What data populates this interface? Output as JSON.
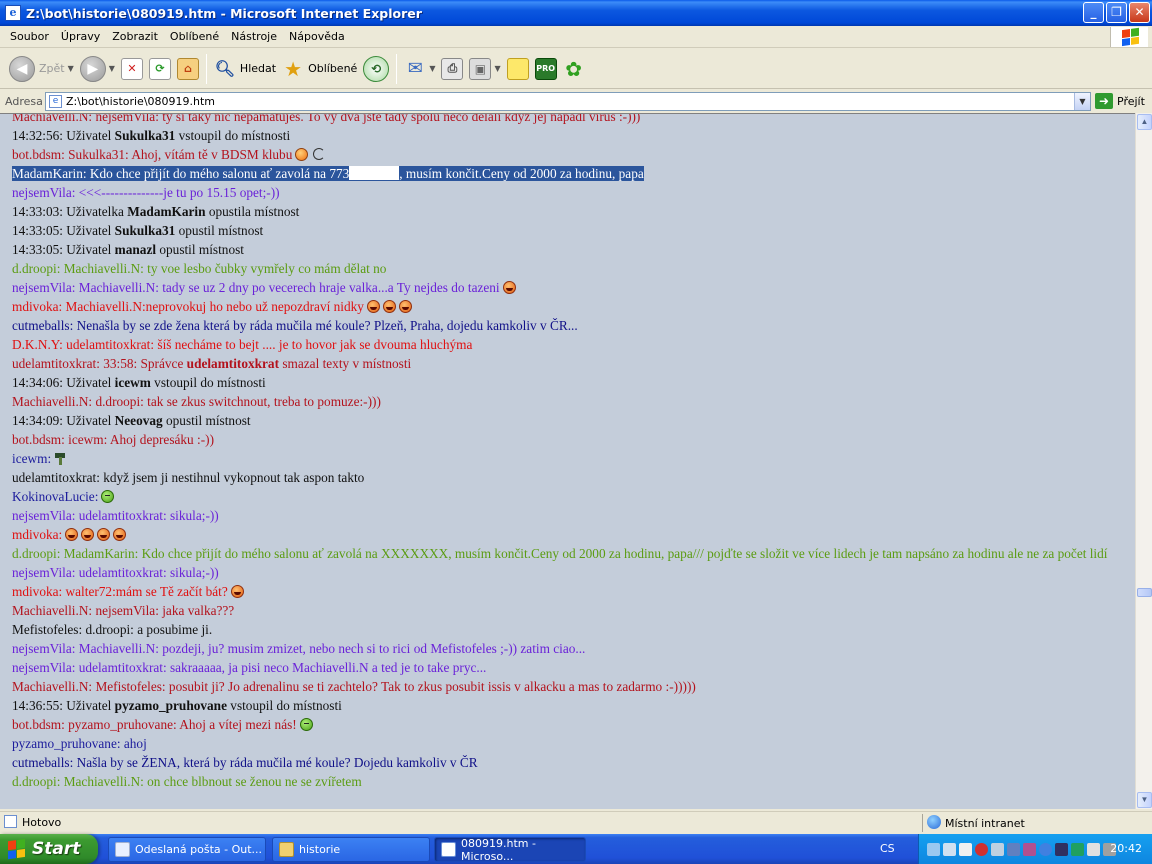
{
  "window": {
    "title": "Z:\\bot\\historie\\080919.htm - Microsoft Internet Explorer"
  },
  "menu": [
    "Soubor",
    "Úpravy",
    "Zobrazit",
    "Oblíbené",
    "Nástroje",
    "Nápověda"
  ],
  "toolbar": {
    "back_label": "Zpět",
    "search_label": "Hledat",
    "favorites_label": "Oblíbené"
  },
  "address": {
    "label": "Adresa",
    "value": "Z:\\bot\\historie\\080919.htm",
    "go_label": "Přejít"
  },
  "chat": [
    {
      "color": "c-darkred",
      "text": "Machiavelli.N: nejsemVila: ty si taky nic nepamatujes. To vy dva jste tady spolu neco delali kdyz jej napadl virus :-)))"
    },
    {
      "color": "c-black",
      "parts": [
        {
          "t": "14:32:56: Uživatel "
        },
        {
          "t": "Sukulka31",
          "b": true
        },
        {
          "t": " vstoupil do místnosti"
        }
      ]
    },
    {
      "color": "c-darkred",
      "text": "bot.bdsm: Sukulka31: Ahoj, vítám tě v BDSM klubu",
      "emo": [
        "blink",
        "whip"
      ]
    },
    {
      "color": "sel",
      "parts": [
        {
          "t": "MadamKarin: Kdo chce přijít do mého salonu ať zavolá na 773"
        },
        {
          "redact": true
        },
        {
          "t": ", musím končit.Ceny od 2000 za hodinu, papa"
        }
      ]
    },
    {
      "color": "c-purple",
      "text": "nejsemVila: <<<--------------je tu po 15.15 opet;-))"
    },
    {
      "color": "c-black",
      "parts": [
        {
          "t": "14:33:03: Uživatelka "
        },
        {
          "t": "MadamKarin",
          "b": true
        },
        {
          "t": " opustila místnost"
        }
      ]
    },
    {
      "color": "c-black",
      "parts": [
        {
          "t": "14:33:05: Uživatel "
        },
        {
          "t": "Sukulka31",
          "b": true
        },
        {
          "t": " opustil místnost"
        }
      ]
    },
    {
      "color": "c-black",
      "parts": [
        {
          "t": "14:33:05: Uživatel "
        },
        {
          "t": "manazl",
          "b": true
        },
        {
          "t": " opustil místnost"
        }
      ]
    },
    {
      "color": "c-green",
      "text": "d.droopi: Machiavelli.N: ty voe lesbo čubky vymřely co mám dělat no"
    },
    {
      "color": "c-purple",
      "text": "nejsemVila: Machiavelli.N: tady se uz 2 dny po vecerech hraje valka...a Ty nejdes do tazeni",
      "emo": [
        "laugh"
      ]
    },
    {
      "color": "c-bright",
      "text": "mdivoka: Machiavelli.N:neprovokuj ho nebo už nepozdraví nidky",
      "emo": [
        "laugh",
        "laugh",
        "laugh"
      ]
    },
    {
      "color": "c-navy",
      "text": "cutmeballs: Nenašla by se zde žena která by ráda mučila mé koule? Plzeň, Praha, dojedu kamkoliv v ČR..."
    },
    {
      "color": "c-bright",
      "text": "D.K.N.Y: udelamtitoxkrat: šíš necháme to bejt .... je to hovor jak se dvouma hluchýma"
    },
    {
      "color": "c-darkred",
      "parts": [
        {
          "t": "udelamtitoxkrat: 33:58: Správce "
        },
        {
          "t": "udelamtitoxkrat",
          "b": true
        },
        {
          "t": " smazal texty v místnosti"
        }
      ]
    },
    {
      "color": "c-black",
      "parts": [
        {
          "t": "14:34:06: Uživatel "
        },
        {
          "t": "icewm",
          "b": true
        },
        {
          "t": " vstoupil do místnosti"
        }
      ]
    },
    {
      "color": "c-darkred",
      "text": "Machiavelli.N: d.droopi: tak se zkus switchnout, treba to pomuze:-)))"
    },
    {
      "color": "c-black",
      "parts": [
        {
          "t": "14:34:09: Uživatel "
        },
        {
          "t": "Neeovag",
          "b": true
        },
        {
          "t": " opustil místnost"
        }
      ]
    },
    {
      "color": "c-darkred",
      "text": "bot.bdsm: icewm: Ahoj depresáku :-))"
    },
    {
      "color": "c-blue",
      "text": "icewm:",
      "emo": [
        "hammer"
      ]
    },
    {
      "color": "c-black",
      "text": "udelamtitoxkrat: když jsem ji nestihnul vykopnout tak aspon takto"
    },
    {
      "color": "c-blue",
      "text": "KokinovaLucie:",
      "emo": [
        "smile"
      ]
    },
    {
      "color": "c-purple",
      "text": "nejsemVila: udelamtitoxkrat: sikula;-))"
    },
    {
      "color": "c-bright",
      "text": "mdivoka:",
      "emo": [
        "laugh",
        "laugh",
        "laugh",
        "laugh"
      ]
    },
    {
      "color": "c-green",
      "wrap": true,
      "text": "d.droopi: MadamKarin: Kdo chce přijít do mého salonu ať zavolá na XXXXXXX, musím končit.Ceny od 2000 za hodinu, papa/// pojďte se složit ve více lidech je tam napsáno za hodinu ale ne za počet lidí"
    },
    {
      "color": "c-purple",
      "text": "nejsemVila: udelamtitoxkrat: sikula;-))"
    },
    {
      "color": "c-bright",
      "text": "mdivoka: walter72:mám se Tě začít bát?",
      "emo": [
        "laugh"
      ]
    },
    {
      "color": "c-darkred",
      "text": "Machiavelli.N: nejsemVila: jaka valka???"
    },
    {
      "color": "c-black",
      "text": "Mefistofeles: d.droopi: a posubime ji."
    },
    {
      "color": "c-purple",
      "text": "nejsemVila: Machiavelli.N: pozdeji, ju? musim zmizet, nebo nech si to rici od Mefistofeles ;-)) zatim ciao..."
    },
    {
      "color": "c-purple",
      "text": "nejsemVila: udelamtitoxkrat: sakraaaaa, ja pisi neco Machiavelli.N a ted je to take pryc..."
    },
    {
      "color": "c-darkred",
      "text": "Machiavelli.N: Mefistofeles: posubit ji? Jo adrenalinu se ti zachtelo? Tak to zkus posubit issis v alkacku a mas to zadarmo :-)))))"
    },
    {
      "color": "c-black",
      "parts": [
        {
          "t": "14:36:55: Uživatel "
        },
        {
          "t": "pyzamo_pruhovane",
          "b": true
        },
        {
          "t": " vstoupil do místnosti"
        }
      ]
    },
    {
      "color": "c-darkred",
      "text": "bot.bdsm: pyzamo_pruhovane: Ahoj a vítej mezi nás!",
      "emo": [
        "smile"
      ]
    },
    {
      "color": "c-blue",
      "text": "pyzamo_pruhovane: ahoj"
    },
    {
      "color": "c-navy",
      "text": "cutmeballs: Našla by se ŽENA, která by ráda mučila mé koule? Dojedu kamkoliv v ČR"
    },
    {
      "color": "c-green",
      "text": "d.droopi: Machiavelli.N: on chce blbnout se ženou ne se zvířetem"
    }
  ],
  "status": {
    "text": "Hotovo",
    "zone": "Místní intranet"
  },
  "taskbar": {
    "start_label": "Start",
    "tasks": [
      {
        "label": "Odeslaná pošta - Out..."
      },
      {
        "label": "historie"
      },
      {
        "label": "080919.htm - Microso..."
      }
    ],
    "lang": "CS",
    "clock": "20:42"
  },
  "colors": {
    "content_bg": "#C4CDDA",
    "selection": "#2B559C",
    "titlebar": "#0054E3",
    "taskbar": "#245EDC",
    "start": "#3C9A30"
  },
  "icons": [
    "ie-icon",
    "back-icon",
    "forward-icon",
    "stop-icon",
    "refresh-icon",
    "home-icon",
    "search-icon",
    "favorites-star-icon",
    "history-icon",
    "mail-icon",
    "print-icon",
    "edit-icon",
    "note-icon",
    "icq-pro-icon",
    "icq-flower-icon"
  ]
}
